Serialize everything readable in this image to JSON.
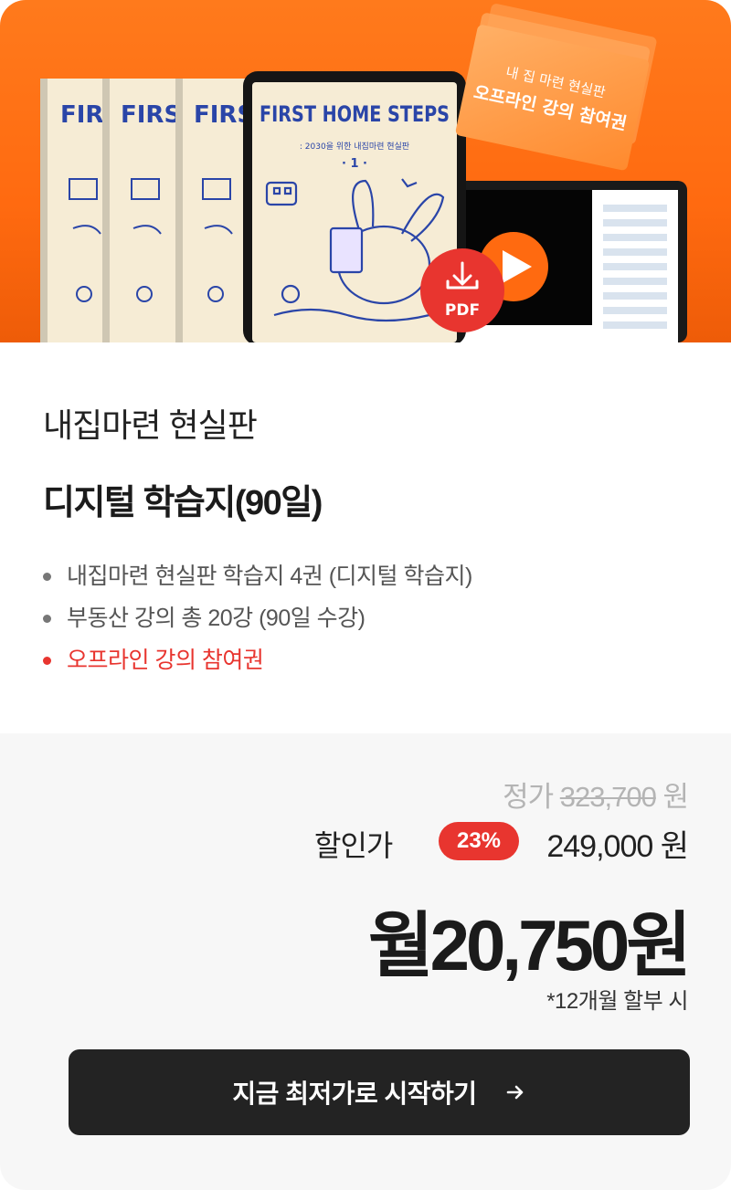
{
  "hero": {
    "book_cover_title": "FIRST HOME STEPS",
    "book_cover_small": "FIRST",
    "book_cover_subtitle": ": 2030을 위한 내집마련 현실판",
    "book_cover_volume": "· 1 ·",
    "ticket_line1": "내 집 마련 현실판",
    "ticket_line2": "오프라인 강의 참여권",
    "pdf_label": "PDF",
    "colors": {
      "background": "#ff6a10",
      "pdf_badge": "#e8352f",
      "play_button": "#ff6a10",
      "book_cover": "#f6ecd5",
      "book_ink": "#2a45a8"
    },
    "icons": [
      "download-icon",
      "play-icon"
    ]
  },
  "product": {
    "subtitle": "내집마련 현실판",
    "title": "디지털 학습지(90일)",
    "features": [
      {
        "text": "내집마련 현실판 학습지 4권 (디지털 학습지)",
        "highlight": false
      },
      {
        "text": "부동산 강의 총 20강 (90일 수강)",
        "highlight": false
      },
      {
        "text": "오프라인 강의 참여권",
        "highlight": true
      }
    ]
  },
  "pricing": {
    "original_label": "정가",
    "original_price": "323,700",
    "original_unit": "원",
    "discount_label": "할인가",
    "discount_rate": "23%",
    "discount_price": "249,000 원",
    "monthly_price": "월20,750원",
    "installment_note": "*12개월 할부 시"
  },
  "cta": {
    "label": "지금 최저가로 시작하기",
    "icon": "arrow-right-icon"
  },
  "colors": {
    "accent": "#e8352f",
    "cta_bg": "#232323",
    "price_bg": "#f7f7f7"
  }
}
